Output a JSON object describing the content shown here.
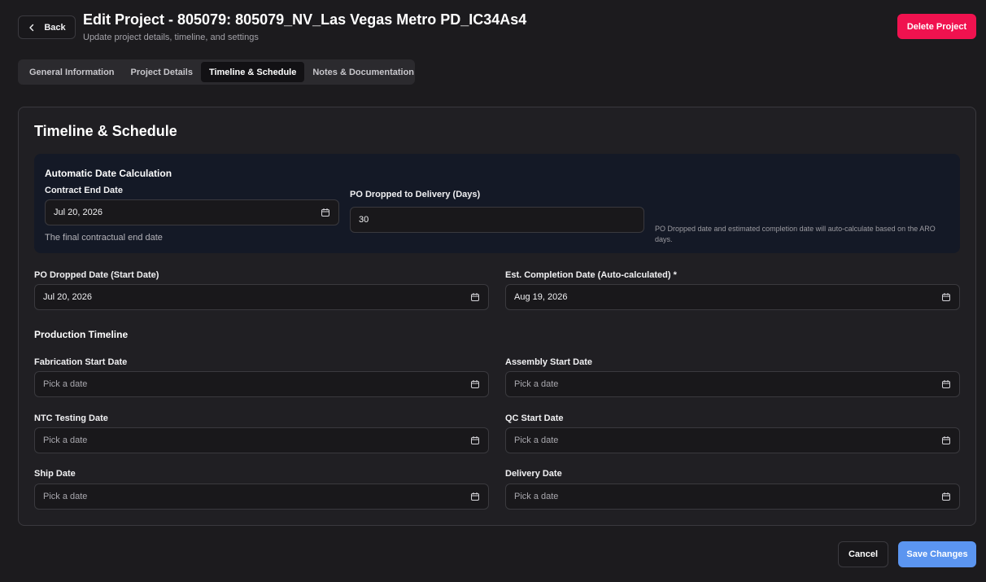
{
  "header": {
    "back_label": "Back",
    "title": "Edit Project - 805079: 805079_NV_Las Vegas Metro PD_IC34As4",
    "subtitle": "Update project details, timeline, and settings",
    "delete_label": "Delete Project"
  },
  "tabs": [
    {
      "label": "General Information",
      "active": false
    },
    {
      "label": "Project Details",
      "active": false
    },
    {
      "label": "Timeline & Schedule",
      "active": true
    },
    {
      "label": "Notes & Documentation",
      "active": false
    }
  ],
  "card": {
    "title": "Timeline & Schedule",
    "auto_calc": {
      "title": "Automatic Date Calculation",
      "contract_end": {
        "label": "Contract End Date",
        "value": "Jul 20, 2026",
        "helper": "The final contractual end date"
      },
      "po_to_delivery": {
        "label": "PO Dropped to Delivery (Days)",
        "value": "30"
      },
      "note": "PO Dropped date and estimated completion date will auto-calculate based on the ARO days."
    },
    "po_dropped": {
      "label": "PO Dropped Date (Start Date)",
      "value": "Jul 20, 2026"
    },
    "est_completion": {
      "label": "Est. Completion Date (Auto-calculated) *",
      "value": "Aug 19, 2026"
    },
    "production": {
      "title": "Production Timeline",
      "placeholder": "Pick a date",
      "fabrication": {
        "label": "Fabrication Start Date"
      },
      "assembly": {
        "label": "Assembly Start Date"
      },
      "ntc": {
        "label": "NTC Testing Date"
      },
      "qc": {
        "label": "QC Start Date"
      },
      "ship": {
        "label": "Ship Date"
      },
      "delivery": {
        "label": "Delivery Date"
      }
    }
  },
  "footer": {
    "cancel_label": "Cancel",
    "save_label": "Save Changes"
  },
  "colors": {
    "background": "#1c1b1e",
    "accent_delete": "#f0124f",
    "accent_save": "#5b95f0",
    "auto_box": "#141926"
  },
  "icons": [
    "chevron-left-icon",
    "calendar-icon"
  ]
}
